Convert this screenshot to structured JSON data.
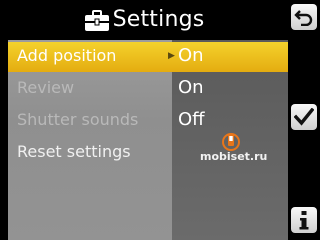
{
  "header": {
    "title": "Settings",
    "icon": "toolbox-icon"
  },
  "settings": [
    {
      "label": "Add position",
      "value": "On",
      "selected": true,
      "enabled": true
    },
    {
      "label": "Review",
      "value": "On",
      "selected": false,
      "enabled": false
    },
    {
      "label": "Shutter sounds",
      "value": "Off",
      "selected": false,
      "enabled": false
    },
    {
      "label": "Reset settings",
      "value": "",
      "selected": false,
      "enabled": true
    }
  ],
  "softkeys": {
    "back": "back-arrow-icon",
    "confirm": "checkmark-icon",
    "info": "info-icon"
  },
  "watermark": {
    "text": "mobiset.ru"
  },
  "colors": {
    "highlight": "#f0c420",
    "label_panel": "#959595",
    "value_panel": "#636363",
    "background": "#000000",
    "watermark_accent": "#e8761a"
  }
}
